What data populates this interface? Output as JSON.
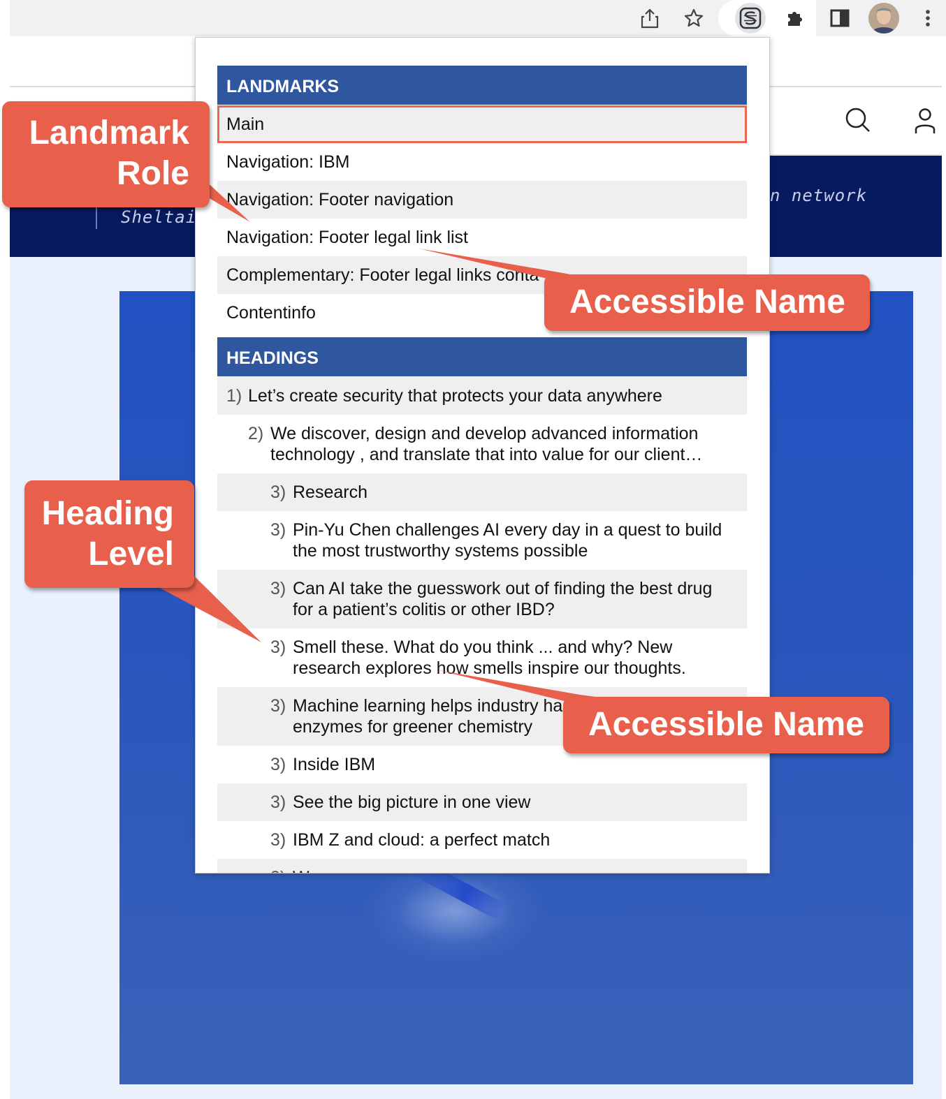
{
  "browser": {
    "icons": [
      "share-icon",
      "star-icon",
      "headings-map-extension-icon",
      "puzzle-icon",
      "side-panel-icon",
      "avatar",
      "more-vert-icon"
    ]
  },
  "page": {
    "band_text_left": "Sheltai",
    "band_text_right": "n network",
    "icons": [
      "search-icon",
      "user-icon"
    ]
  },
  "popup": {
    "landmarks_header": "LANDMARKS",
    "landmarks": [
      "Main",
      "Navigation: IBM",
      "Navigation: Footer navigation",
      "Navigation: Footer legal link list",
      "Complementary: Footer legal links conta",
      "Contentinfo"
    ],
    "selected_landmark": "Main",
    "headings_header": "HEADINGS",
    "headings": [
      {
        "level": "1)",
        "lines": [
          "Let’s create security that protects your data anywhere"
        ]
      },
      {
        "level": "2)",
        "lines": [
          "We discover, design and develop advanced information",
          "technology , and translate that into value for our client…"
        ]
      },
      {
        "level": "3)",
        "lines": [
          "Research"
        ]
      },
      {
        "level": "3)",
        "lines": [
          "Pin-Yu Chen challenges AI every day in a quest to build",
          "the most trustworthy systems possible"
        ]
      },
      {
        "level": "3)",
        "lines": [
          "Can AI take the guesswork out of finding the best drug",
          "for a patient’s colitis or other IBD?"
        ]
      },
      {
        "level": "3)",
        "lines": [
          "Smell these. What do you think ... and why? New",
          "research explores how smells inspire our thoughts."
        ]
      },
      {
        "level": "3)",
        "lines": [
          "Machine learning helps industry ha",
          "enzymes for greener chemistry"
        ]
      },
      {
        "level": "3)",
        "lines": [
          "Inside IBM"
        ]
      },
      {
        "level": "3)",
        "lines": [
          "See the big picture in one view"
        ]
      },
      {
        "level": "3)",
        "lines": [
          "IBM Z and cloud: a perfect match"
        ]
      },
      {
        "level": "3)",
        "lines": [
          "W"
        ]
      }
    ]
  },
  "callouts": {
    "landmark_role": [
      "Landmark",
      "Role"
    ],
    "heading_level": [
      "Heading",
      "Level"
    ],
    "accessible_name_1": "Accessible Name",
    "accessible_name_2": "Accessible Name"
  },
  "colors": {
    "header_blue": "#2e579f",
    "callout_red": "#e8604c",
    "selected_border": "#e8694f",
    "row_shade": "#efefef"
  }
}
